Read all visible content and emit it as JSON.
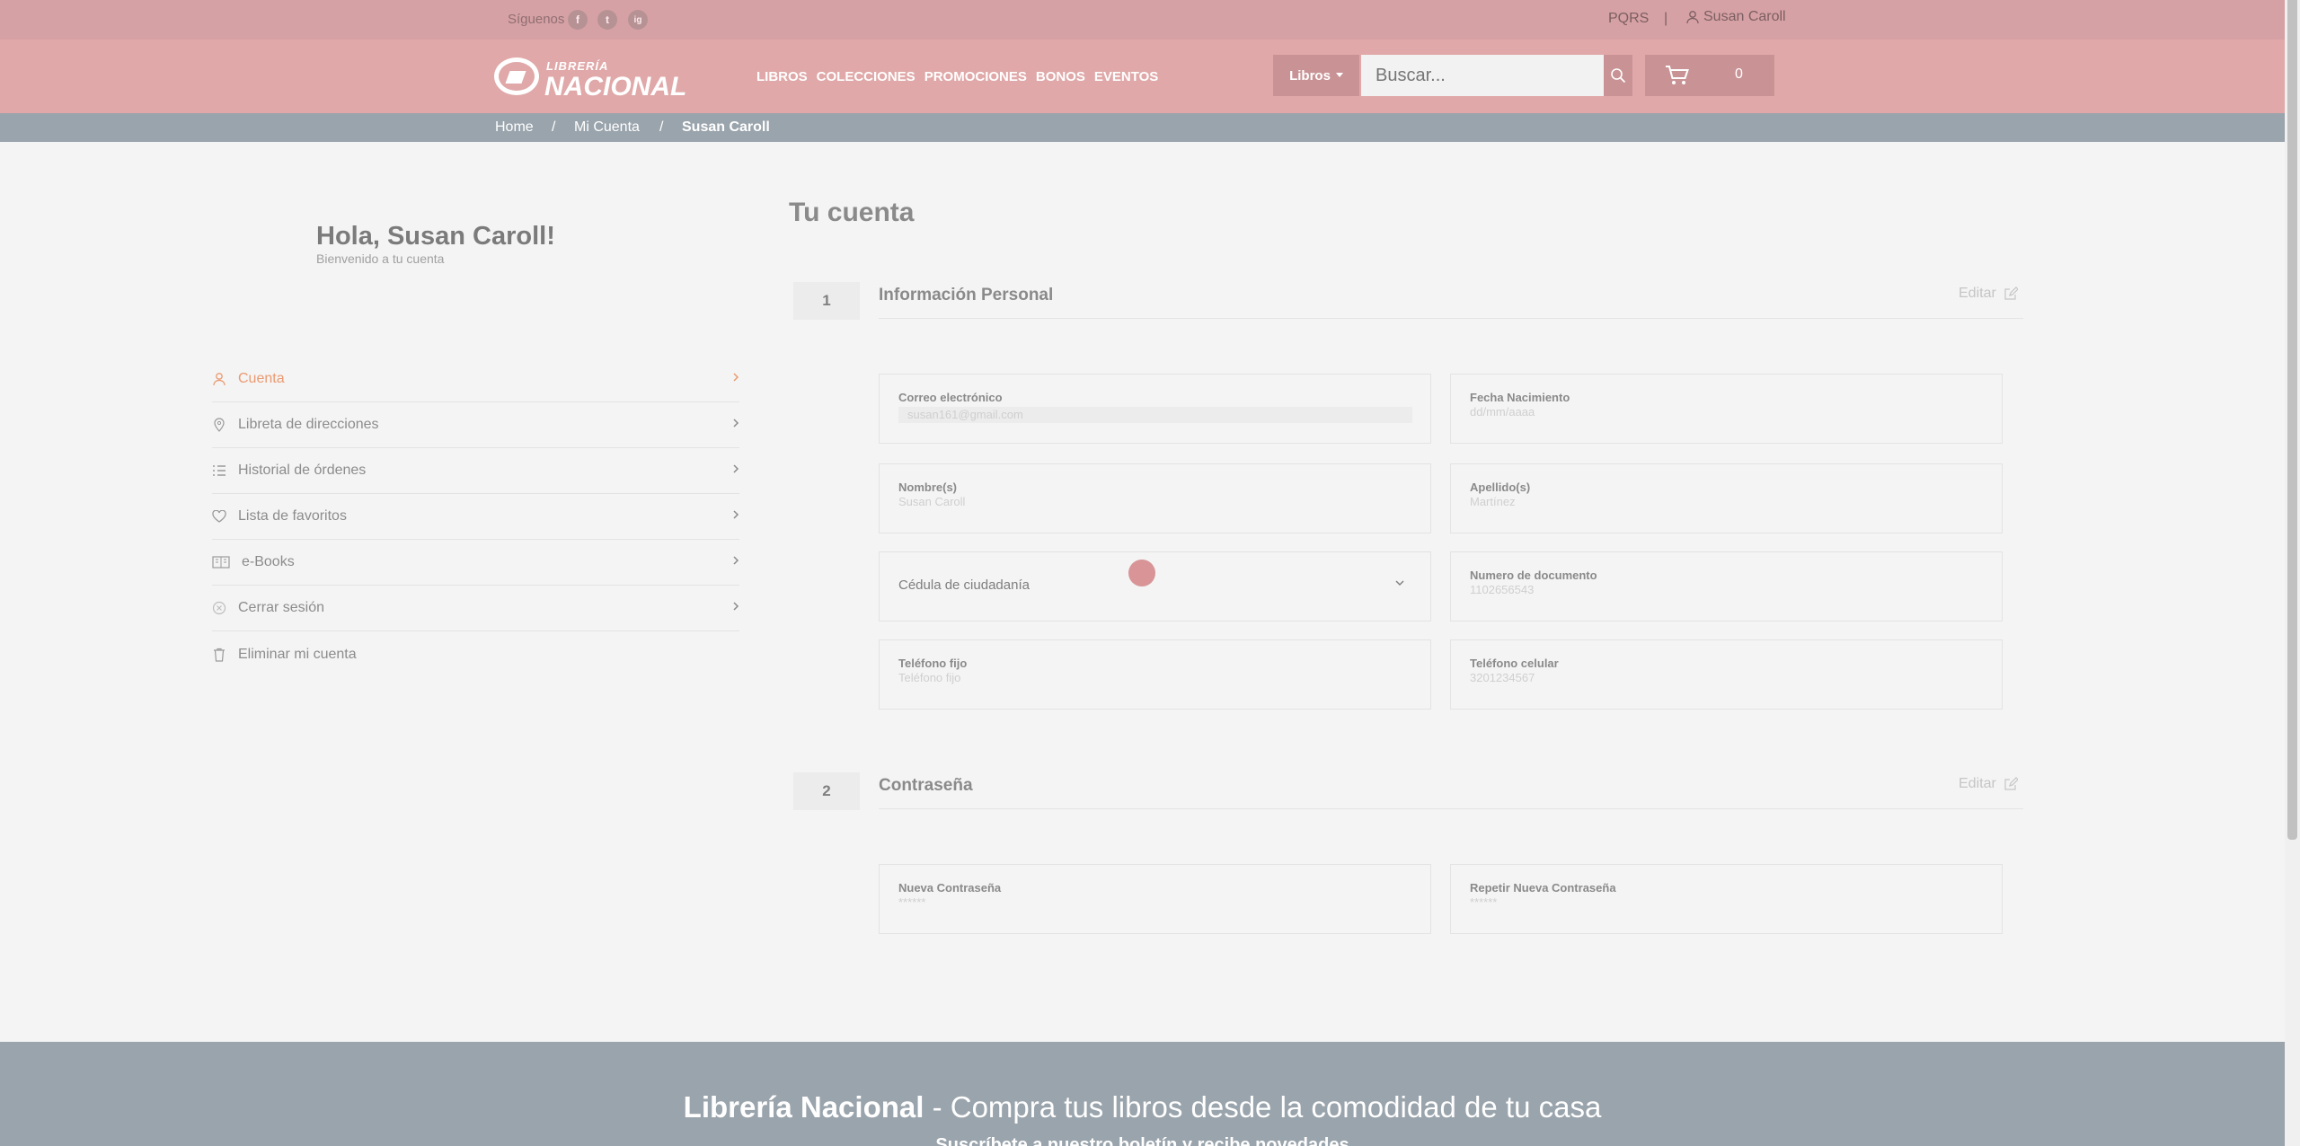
{
  "topbar": {
    "follow_label": "Síguenos",
    "social": [
      "f",
      "t",
      "ig"
    ],
    "social_names": [
      "facebook-icon",
      "twitter-icon",
      "instagram-icon"
    ],
    "pqrs": "PQRS",
    "separator": "|",
    "user_name": "Susan Caroll"
  },
  "header": {
    "logo_small": "LIBRERÍA",
    "logo_big": "NACIONAL",
    "nav": [
      "LIBROS",
      "COLECCIONES",
      "PROMOCIONES",
      "BONOS",
      "EVENTOS"
    ],
    "category_button": "Libros",
    "search_placeholder": "Buscar...",
    "cart_count": "0"
  },
  "breadcrumb": {
    "items": [
      "Home",
      "/",
      "Mi Cuenta",
      "/",
      "Susan Caroll"
    ]
  },
  "sidebar": {
    "greeting": "Hola, Susan Caroll!",
    "welcome": "Bienvenido a tu cuenta",
    "items": [
      {
        "label": "Cuenta",
        "icon": "user-icon"
      },
      {
        "label": "Libreta de direcciones",
        "icon": "location-pin-icon"
      },
      {
        "label": "Historial de órdenes",
        "icon": "list-icon"
      },
      {
        "label": "Lista de favoritos",
        "icon": "heart-icon"
      },
      {
        "label": "e-Books",
        "icon": "book-icon"
      },
      {
        "label": "Cerrar sesión",
        "icon": "logout-icon"
      },
      {
        "label": "Eliminar mi cuenta",
        "icon": "trash-icon"
      }
    ]
  },
  "main": {
    "title": "Tu cuenta",
    "section1": {
      "number": "1",
      "title": "Información Personal",
      "edit": "Editar",
      "fields": {
        "email": {
          "label": "Correo electrónico",
          "value": "susan161@gmail.com"
        },
        "birth": {
          "label": "Fecha Nacimiento",
          "value": "dd/mm/aaaa"
        },
        "names": {
          "label": "Nombre(s)",
          "value": "Susan Caroll"
        },
        "surnames": {
          "label": "Apellido(s)",
          "value": "Martínez"
        },
        "doc_type": {
          "value": "Cédula de ciudadanía"
        },
        "doc_number": {
          "label": "Numero de documento",
          "value": "1102656543"
        },
        "phone": {
          "label": "Teléfono fijo",
          "value": "Teléfono fijo"
        },
        "mobile": {
          "label": "Teléfono celular",
          "value": "3201234567"
        }
      }
    },
    "section2": {
      "number": "2",
      "title": "Contraseña",
      "edit": "Editar",
      "fields": {
        "new_password": {
          "label": "Nueva Contraseña",
          "value": "******"
        },
        "repeat_password": {
          "label": "Repetir Nueva Contraseña",
          "value": "******"
        }
      }
    }
  },
  "footer": {
    "brand": "Librería Nacional",
    "tagline": " - Compra tus libros desde la comodidad de tu casa",
    "line2": "Suscríbete a nuestro boletín y recibe novedades"
  },
  "colors": {
    "topbar": "#d6a1a5",
    "header": "#e0a8a8",
    "accent": "#ea9a72",
    "breadcrumb": "#9aa4ac"
  }
}
